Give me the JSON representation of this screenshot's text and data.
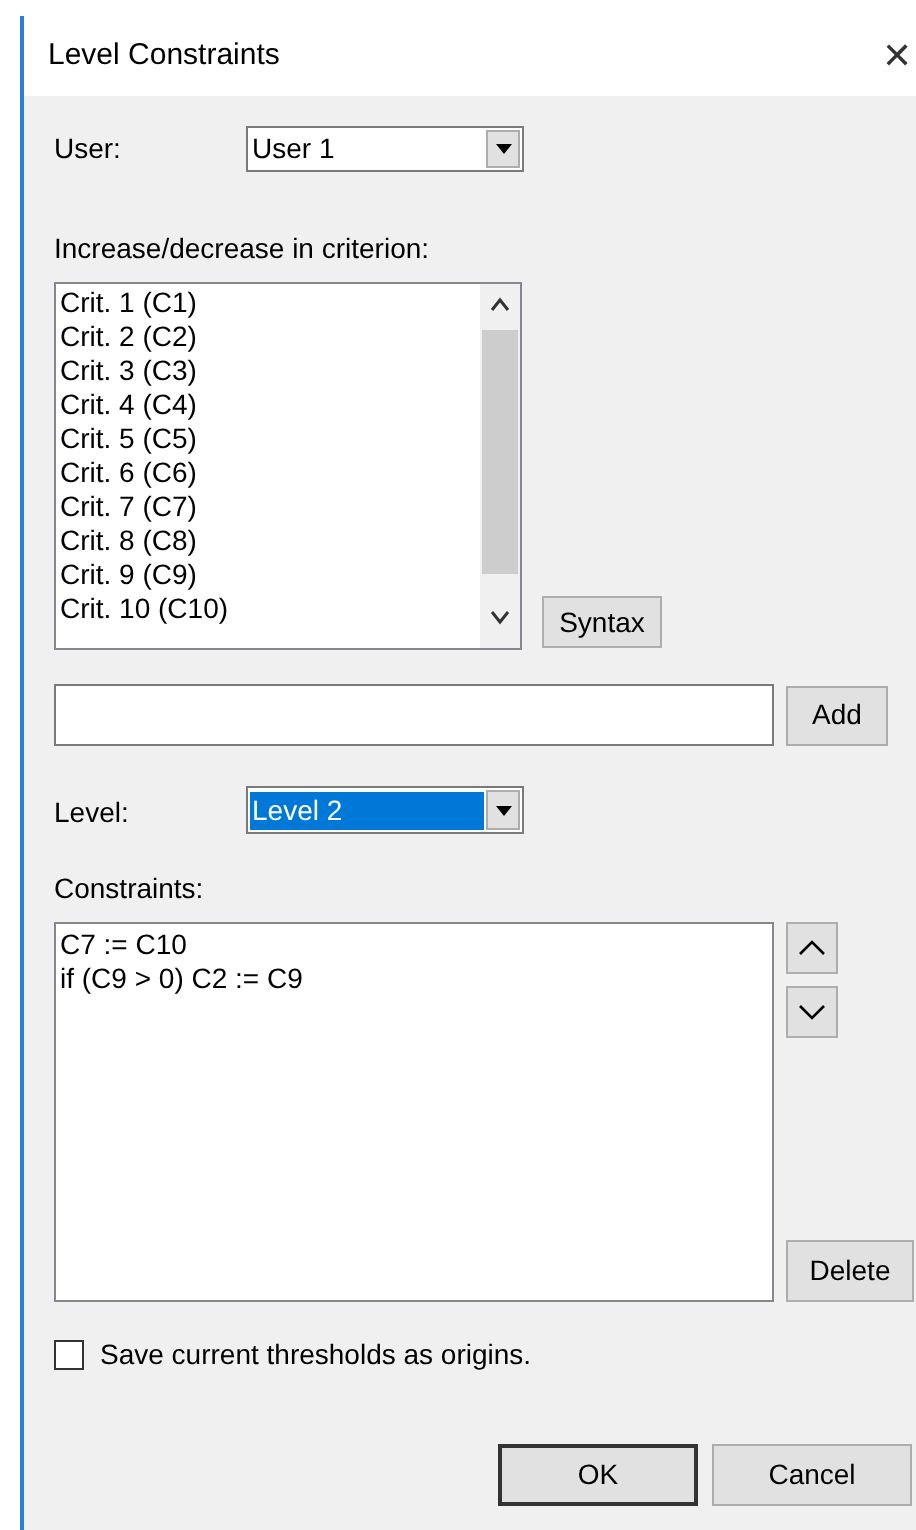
{
  "window": {
    "title": "Level Constraints",
    "close": "✕"
  },
  "user": {
    "label": "User:",
    "value": "User 1"
  },
  "criteria": {
    "label": "Increase/decrease in criterion:",
    "items": [
      {
        "text": "Crit. 1 (C1)"
      },
      {
        "text": "Crit. 2 (C2)"
      },
      {
        "text": "Crit. 3 (C3)"
      },
      {
        "text": "Crit. 4 (C4)"
      },
      {
        "text": "Crit. 5 (C5)"
      },
      {
        "text": "Crit. 6 (C6)"
      },
      {
        "text": "Crit. 7 (C7)"
      },
      {
        "text": "Crit. 8 (C8)"
      },
      {
        "text": "Crit. 9 (C9)"
      },
      {
        "text": "Crit. 10 (C10)"
      }
    ],
    "syntax_button": "Syntax"
  },
  "expression": {
    "add_button": "Add"
  },
  "level": {
    "label": "Level:",
    "value": "Level 2",
    "selected": true
  },
  "constraints": {
    "label": "Constraints:",
    "lines": [
      "C7 := C10",
      "if (C9 > 0) C2 := C9"
    ],
    "delete_button": "Delete"
  },
  "save_thresholds": {
    "label": "Save current thresholds as origins.",
    "checked": false
  },
  "buttons": [
    {
      "label": "OK"
    },
    {
      "label": "Cancel"
    }
  ]
}
